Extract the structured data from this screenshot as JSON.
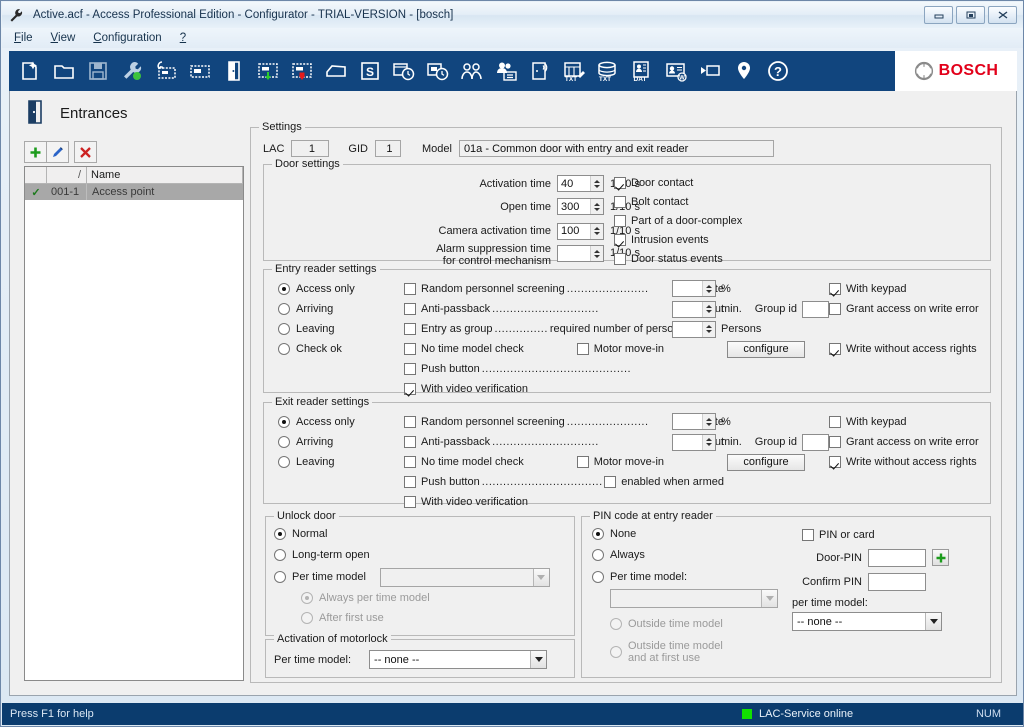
{
  "window": {
    "title": "Active.acf - Access Professional Edition - Configurator - TRIAL-VERSION - [bosch]",
    "icon": "wrench-icon",
    "controls": [
      {
        "name": "minimize-button",
        "label": "Minimize"
      },
      {
        "name": "maximize-button",
        "label": "Maximize"
      },
      {
        "name": "close-button",
        "label": "Close"
      }
    ]
  },
  "menu": {
    "items": [
      {
        "label": "File",
        "accel": "F"
      },
      {
        "label": "View",
        "accel": "V"
      },
      {
        "label": "Configuration",
        "accel": "C"
      },
      {
        "label": "?",
        "accel": ""
      }
    ]
  },
  "toolbar": {
    "icons": [
      "new-file-icon",
      "open-folder-icon",
      "save-icon",
      "wrench-green-icon",
      "device-config-icon",
      "card-reader-icon",
      "door-icon",
      "entrance-green-icon",
      "entrance-red-icon",
      "area-icon",
      "schedule-s-icon",
      "time-model-icon",
      "day-model-icon",
      "persons-icon",
      "person-card-icon",
      "wireless-door-icon",
      "txt-import-icon",
      "txt-export-icon",
      "data-export-icon",
      "card-design-icon",
      "video-device-icon",
      "location-pin-icon",
      "help-icon"
    ],
    "brand": "BOSCH",
    "brand_color": "#e2001a",
    "bg_color": "#11457e"
  },
  "page": {
    "title": "Entrances",
    "icon": "door-icon"
  },
  "sidebar": {
    "tools": [
      {
        "name": "add-entrance-button",
        "icon": "plus-icon",
        "color": "#1d9c1d"
      },
      {
        "name": "edit-entrance-button",
        "icon": "pencil-icon",
        "color": "#2a64c8"
      },
      {
        "name": "delete-entrance-button",
        "icon": "delete-x-icon",
        "color": "#cc2222"
      }
    ],
    "columns": [
      "",
      "",
      "Name"
    ],
    "rows": [
      {
        "check": "✓",
        "id": "001-1",
        "name": "Access point",
        "selected": true
      }
    ]
  },
  "settings": {
    "group_title": "Settings",
    "lac_label": "LAC",
    "lac_value": "1",
    "gid_label": "GID",
    "gid_value": "1",
    "model_label": "Model",
    "model_value": "01a - Common door with entry and exit reader"
  },
  "door_settings": {
    "group_title": "Door settings",
    "fields": [
      {
        "label": "Activation time",
        "value": "40",
        "unit": "1/10 s"
      },
      {
        "label": "Open time",
        "value": "300",
        "unit": "1/10 s"
      },
      {
        "label": "Camera activation time",
        "value": "100",
        "unit": "1/10 s"
      },
      {
        "label": "Alarm suppression time for control mechanism",
        "value": "",
        "unit": "1/10 s"
      }
    ],
    "checkboxes": [
      {
        "label": "Door contact",
        "checked": true
      },
      {
        "label": "Bolt contact",
        "checked": false
      },
      {
        "label": "Part of a door-complex",
        "checked": false
      },
      {
        "label": "Intrusion events",
        "checked": true
      },
      {
        "label": "Door status events",
        "checked": false
      }
    ]
  },
  "entry_reader": {
    "group_title": "Entry reader settings",
    "modes": [
      {
        "label": "Access only",
        "selected": true
      },
      {
        "label": "Arriving",
        "selected": false
      },
      {
        "label": "Leaving",
        "selected": false
      },
      {
        "label": "Check ok",
        "selected": false
      }
    ],
    "random_screening": {
      "label": "Random personnel screening",
      "checked": false,
      "rate_label": "Rate",
      "rate_value": "",
      "rate_unit": "%"
    },
    "anti_passback": {
      "label": "Anti-passback",
      "checked": false,
      "timeout_label": "Timeout",
      "timeout_value": "",
      "timeout_unit": "min.",
      "group_id_label": "Group id",
      "group_id_value": ""
    },
    "entry_as_group": {
      "label": "Entry as group",
      "mid_label": "required number of persons",
      "checked": false,
      "persons_value": "",
      "persons_unit": "Persons"
    },
    "no_time_model": {
      "label": "No time model check",
      "checked": false
    },
    "motor_move_in": {
      "label": "Motor move-in",
      "checked": false
    },
    "configure_button": "configure",
    "push_button": {
      "label": "Push button",
      "checked": false
    },
    "video_verification": {
      "label": "With video verification",
      "checked": true
    },
    "right_options": [
      {
        "label": "With keypad",
        "checked": true
      },
      {
        "label": "Grant access on write error",
        "checked": false
      },
      {
        "label": "Write without access rights",
        "checked": true
      }
    ]
  },
  "exit_reader": {
    "group_title": "Exit reader settings",
    "modes": [
      {
        "label": "Access only",
        "selected": true
      },
      {
        "label": "Arriving",
        "selected": false
      },
      {
        "label": "Leaving",
        "selected": false
      }
    ],
    "random_screening": {
      "label": "Random personnel screening",
      "checked": false,
      "rate_label": "Rate",
      "rate_value": "",
      "rate_unit": "%"
    },
    "anti_passback": {
      "label": "Anti-passback",
      "checked": false,
      "timeout_label": "Timeout",
      "timeout_value": "",
      "timeout_unit": "min.",
      "group_id_label": "Group id",
      "group_id_value": ""
    },
    "no_time_model": {
      "label": "No time model check",
      "checked": false
    },
    "motor_move_in": {
      "label": "Motor move-in",
      "checked": false
    },
    "configure_button": "configure",
    "push_button": {
      "label": "Push button",
      "checked": false
    },
    "enabled_when_armed": {
      "label": "enabled when armed",
      "checked": false
    },
    "video_verification": {
      "label": "With video verification",
      "checked": false
    },
    "right_options": [
      {
        "label": "With keypad",
        "checked": false
      },
      {
        "label": "Grant access on write error",
        "checked": false
      },
      {
        "label": "Write without access rights",
        "checked": true
      }
    ]
  },
  "unlock_door": {
    "group_title": "Unlock door",
    "options": [
      {
        "label": "Normal",
        "selected": true,
        "disabled": false
      },
      {
        "label": "Long-term open",
        "selected": false,
        "disabled": false
      },
      {
        "label": "Per time model",
        "selected": false,
        "disabled": false
      }
    ],
    "time_model_value": "",
    "sub_options": [
      {
        "label": "Always per time model",
        "selected": true,
        "disabled": true
      },
      {
        "label": "After first use",
        "selected": false,
        "disabled": true
      }
    ]
  },
  "motorlock": {
    "group_title": "Activation of motorlock",
    "label": "Per time model:",
    "value": "-- none --"
  },
  "pin_code": {
    "group_title": "PIN code at entry reader",
    "options": [
      {
        "label": "None",
        "selected": true,
        "disabled": false
      },
      {
        "label": "Always",
        "selected": false,
        "disabled": false
      },
      {
        "label": "Per time model:",
        "selected": false,
        "disabled": false
      }
    ],
    "time_model_value": "",
    "sub_options": [
      {
        "label": "Outside time model",
        "selected": false,
        "disabled": true
      },
      {
        "label": "Outside time model and at first use",
        "selected": false,
        "disabled": true
      }
    ],
    "pin_or_card": {
      "label": "PIN or card",
      "checked": false
    },
    "door_pin_label": "Door-PIN",
    "door_pin_value": "",
    "confirm_pin_label": "Confirm PIN",
    "confirm_pin_value": "",
    "per_time_model_label": "per time model:",
    "per_time_model_value": "-- none --",
    "add_button_icon": "plus-icon"
  },
  "statusbar": {
    "hint": "Press F1 for help",
    "service_status": "LAC-Service online",
    "service_led_color": "#12e000",
    "num_indicator": "NUM"
  }
}
